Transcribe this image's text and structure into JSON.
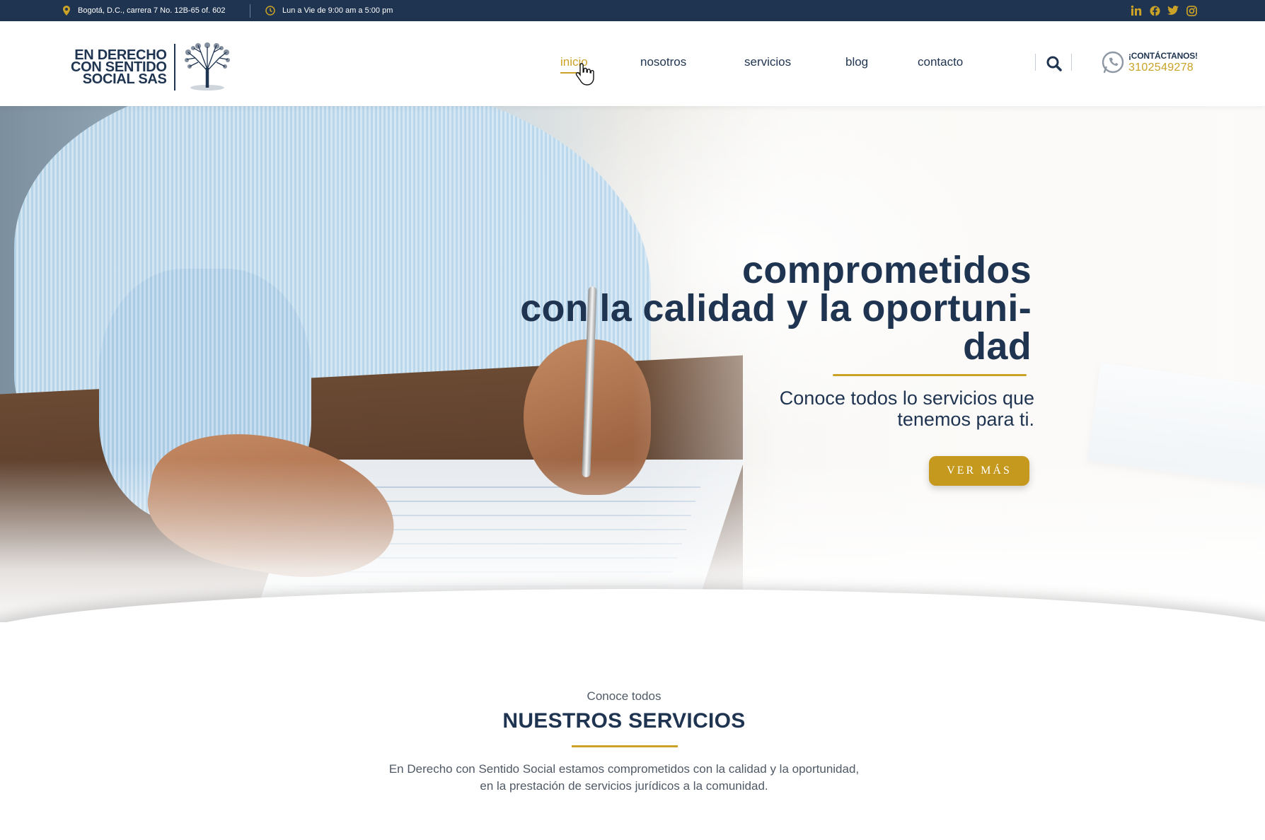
{
  "topbar": {
    "address": "Bogotá, D.C., carrera 7 No. 12B-65 of. 602",
    "hours": "Lun a Vie de 9:00 am a 5:00 pm",
    "socials": [
      {
        "name": "linkedin-icon",
        "glyph": "in"
      },
      {
        "name": "facebook-icon",
        "glyph": "f"
      },
      {
        "name": "twitter-icon",
        "glyph": "t"
      },
      {
        "name": "instagram-icon",
        "glyph": "ig"
      }
    ]
  },
  "header": {
    "logo": {
      "line1": "EN DERECHO",
      "line2": "CON SENTIDO",
      "line3": "SOCIAL SAS"
    },
    "nav": [
      {
        "label": "inicio",
        "active": true
      },
      {
        "label": "nosotros"
      },
      {
        "label": "servicios"
      },
      {
        "label": "blog"
      },
      {
        "label": "contacto"
      }
    ],
    "contact_label": "¡CONTÁCTANOS!",
    "phone": "3102549278"
  },
  "hero": {
    "title_lines": [
      "comprometidos",
      "con la calidad y la oportuni-",
      "dad"
    ],
    "subtitle_lines": [
      "Conoce todos lo servicios que",
      "tenemos para ti."
    ],
    "button": "VER MÁS"
  },
  "services": {
    "kicker": "Conoce todos",
    "title": "NUESTROS SERVICIOS",
    "text_lines": [
      "En Derecho con Sentido Social estamos comprometidos con la calidad y la oportunidad,",
      "en la prestación de servicios jurídicos a la comunidad."
    ]
  },
  "colors": {
    "navy": "#1f3450",
    "gold": "#c9a227",
    "button_gold": "#c5991e"
  }
}
